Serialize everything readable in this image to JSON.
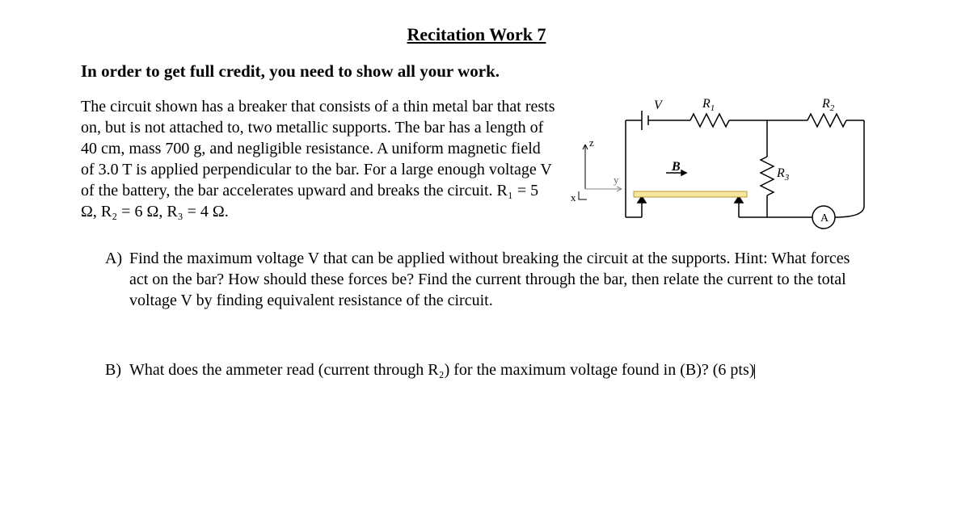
{
  "title": "Recitation Work 7",
  "instruction": "In order to get full credit, you need to show all your work.",
  "problem": "The circuit shown has a breaker that consists of a thin metal bar that rests on, but is not attached to, two metallic supports. The bar has a length of 40 cm, mass 700 g, and negligible resistance. A uniform magnetic field of 3.0 T is applied perpendicular to the bar. For a large enough voltage V of the battery, the bar accelerates upward and breaks the circuit. R₁ = 5 Ω, R₂ = 6 Ω, R₃ = 4 Ω.",
  "questions": {
    "A": {
      "label": "A)",
      "text": "Find the maximum voltage V that can be applied without breaking the circuit at the supports. Hint: What forces act on the bar? How should these forces be? Find the current through the bar, then relate the current to the total voltage V by finding equivalent resistance of the circuit."
    },
    "B": {
      "label": "B)",
      "text": "What does the ammeter read (current through R₂) for the maximum voltage found in (B)? (6 pts)"
    }
  },
  "fig": {
    "V": "V",
    "R1": "R",
    "R1sub": "1",
    "R2": "R",
    "R2sub": "2",
    "R3": "R",
    "R3sub": "3",
    "B": "B",
    "A": "A",
    "x": "x",
    "y": "y",
    "z": "z"
  },
  "chart_data": {
    "type": "diagram",
    "description": "Circuit diagram with battery V, resistor R1 in series, then R3 in parallel with (R2 + ammeter A). A conducting bar rests on supports with magnetic field B in y direction. Coordinate axes x,y,z shown.",
    "components": [
      "V",
      "R1",
      "R2",
      "R3",
      "A",
      "bar",
      "supports",
      "B-field",
      "axes"
    ],
    "values": {
      "R1": 5,
      "R2": 6,
      "R3": 4,
      "bar_length_cm": 40,
      "bar_mass_g": 700,
      "B_T": 3.0
    }
  }
}
